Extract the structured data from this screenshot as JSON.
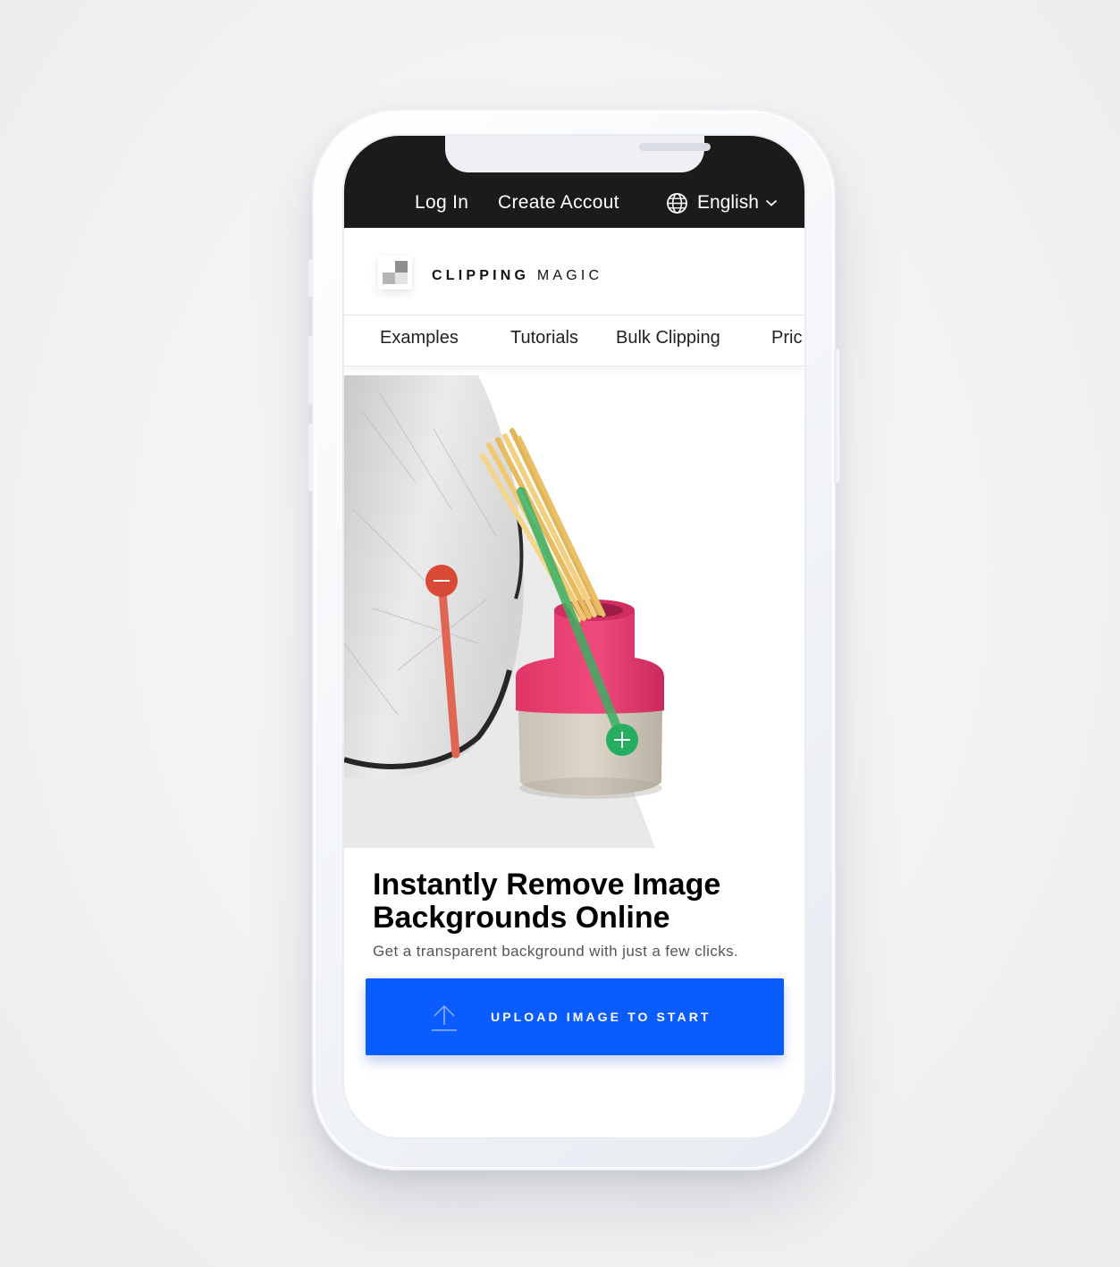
{
  "top_nav": {
    "login_label": "Log In",
    "create_account_label": "Create Accout",
    "language_label": "English",
    "globe_icon": "globe-icon",
    "chevron_icon": "chevron-down-icon"
  },
  "brand": {
    "name_bold": "CLIPPING",
    "name_light": "MAGIC",
    "logo_icon": "checkerboard-logo-icon"
  },
  "main_nav": {
    "items": [
      {
        "label": "Examples"
      },
      {
        "label": "Tutorials"
      },
      {
        "label": "Bulk Clipping"
      },
      {
        "label": "Pric"
      }
    ]
  },
  "hero": {
    "title_line1": "Instantly Remove Image",
    "title_line2": "Backgrounds Online",
    "subtitle": "Get a transparent background with just a few clicks.",
    "remove_marker_icon": "minus-icon",
    "keep_marker_icon": "plus-icon"
  },
  "cta": {
    "upload_label": "UPLOAD IMAGE TO START",
    "upload_icon": "upload-arrow-icon"
  },
  "colors": {
    "top_bar": "#1b1b1b",
    "cta_blue": "#0a5cff",
    "remove_red": "#d94a36",
    "keep_green": "#27ad5f",
    "vase_pink": "#e8336c"
  }
}
